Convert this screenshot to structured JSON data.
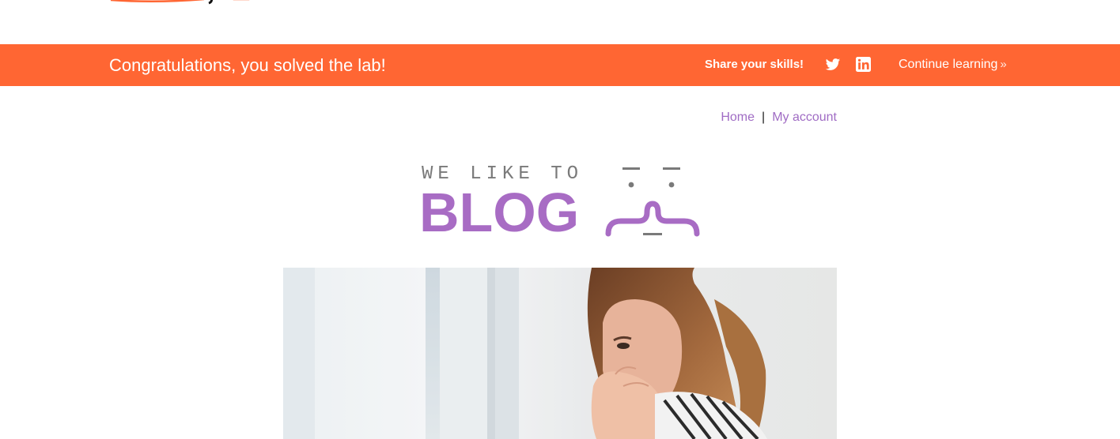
{
  "banner": {
    "title": "Congratulations, you solved the lab!",
    "share_label": "Share your skills!",
    "twitter_icon": "twitter-icon",
    "linkedin_icon": "linkedin-icon",
    "continue_label": "Continue learning",
    "chevron": "»",
    "background": "#ff6633"
  },
  "nav": {
    "home": "Home",
    "separator": "|",
    "account": "My account",
    "link_color": "#a06cc4"
  },
  "logo": {
    "tagline": "WE LIKE TO",
    "word": "BLOG",
    "accent": "#a86cc4"
  },
  "hero": {
    "image": "woman-surprised-photo"
  }
}
